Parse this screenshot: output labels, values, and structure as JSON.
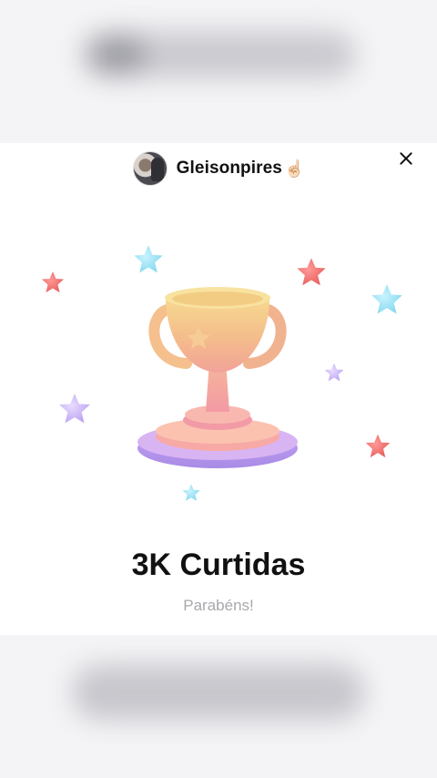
{
  "header": {
    "username": "Gleisonpires",
    "emoji": "☝🏻"
  },
  "award": {
    "title": "3K Curtidas",
    "subtitle": "Parabéns!"
  },
  "icons": {
    "close": "close-icon",
    "trophy": "trophy-icon",
    "stars": "star-icon"
  },
  "colors": {
    "card_bg": "#ffffff",
    "title": "#111111",
    "subtitle": "#a8a8ad"
  }
}
